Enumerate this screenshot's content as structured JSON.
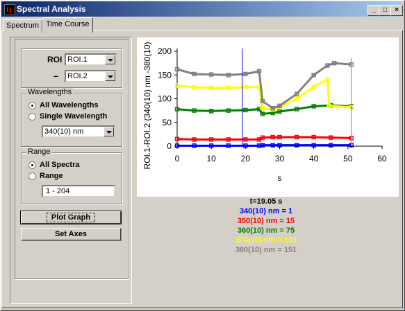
{
  "window": {
    "title": "Spectral Analysis",
    "controls": [
      "_",
      "□",
      "×"
    ]
  },
  "tabs": [
    {
      "label": "Spectrum",
      "active": false
    },
    {
      "label": "Time Course",
      "active": true
    }
  ],
  "roi": {
    "label": "ROI",
    "minus": "–",
    "roi1": "ROI.1",
    "roi2": "ROI.2"
  },
  "wavelengths": {
    "group_label": "Wavelengths",
    "all_label": "All Wavelengths",
    "single_label": "Single Wavelength",
    "selected": "all",
    "single_value": "340(10) nm"
  },
  "range": {
    "group_label": "Range",
    "all_label": "All Spectra",
    "range_label": "Range",
    "selected": "all",
    "value": "1 - 204"
  },
  "buttons": {
    "plot_graph": "Plot Graph",
    "set_axes": "Set Axes"
  },
  "readout": {
    "time": "t=19.05 s",
    "lines": [
      {
        "text": "340(10) nm = 1",
        "color": "#0000ff"
      },
      {
        "text": "350(10) nm = 15",
        "color": "#ff0000"
      },
      {
        "text": "360(10) nm = 75",
        "color": "#008000"
      },
      {
        "text": "370(10) nm = 123",
        "color": "#ffff00"
      },
      {
        "text": "380(10) nm = 151",
        "color": "#808080"
      }
    ]
  },
  "chart_data": {
    "type": "line",
    "xlabel": "s",
    "ylabel": "ROI.1-ROI.2 (340(10) nm -380(10)",
    "xlim": [
      0,
      60
    ],
    "ylim": [
      0,
      200
    ],
    "xticks": [
      0,
      10,
      20,
      30,
      40,
      50,
      60
    ],
    "yticks": [
      0,
      50,
      100,
      150,
      200
    ],
    "cursor_x": 19.05,
    "grid": false,
    "series": [
      {
        "color": "#0000ff",
        "x": [
          0,
          5,
          10,
          15,
          20,
          24,
          25,
          28,
          30,
          35,
          40,
          45,
          51
        ],
        "values": [
          1,
          1,
          1,
          1,
          1,
          1,
          2,
          2,
          2,
          2,
          2,
          2,
          2
        ]
      },
      {
        "color": "#ff0000",
        "x": [
          0,
          5,
          10,
          15,
          20,
          24,
          25,
          28,
          30,
          35,
          40,
          45,
          51
        ],
        "values": [
          15,
          14,
          14,
          14,
          14,
          14,
          18,
          19,
          19,
          19,
          19,
          18,
          17
        ]
      },
      {
        "color": "#008000",
        "x": [
          0,
          5,
          10,
          15,
          20,
          24,
          25,
          28,
          30,
          35,
          40,
          45,
          51
        ],
        "values": [
          78,
          75,
          74,
          75,
          76,
          78,
          68,
          70,
          73,
          78,
          84,
          86,
          84
        ]
      },
      {
        "color": "#ffff00",
        "x": [
          0,
          5,
          10,
          15,
          20,
          24,
          25,
          28,
          30,
          35,
          40,
          44,
          44.5,
          51
        ],
        "values": [
          128,
          124,
          123,
          123,
          124,
          125,
          80,
          77,
          82,
          100,
          125,
          140,
          85,
          82
        ]
      },
      {
        "color": "#808080",
        "x": [
          0,
          5,
          10,
          15,
          20,
          24,
          25,
          28,
          30,
          35,
          40,
          44,
          46,
          51
        ],
        "values": [
          162,
          152,
          151,
          150,
          152,
          158,
          95,
          80,
          85,
          110,
          150,
          170,
          175,
          172
        ]
      }
    ]
  }
}
